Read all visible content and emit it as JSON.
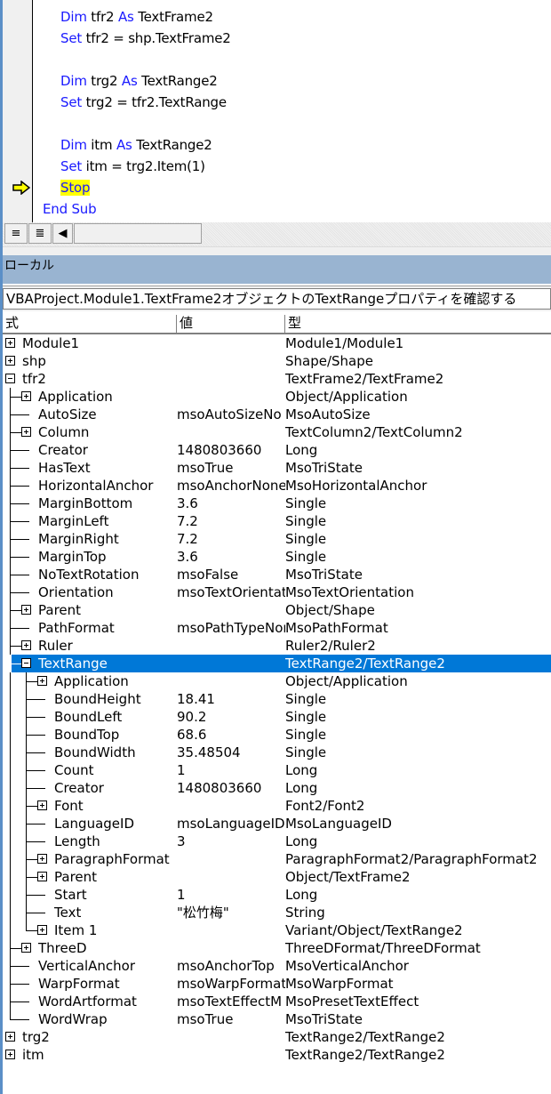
{
  "code": {
    "lines": [
      {
        "indent": 1,
        "parts": [
          {
            "t": "Dim",
            "kw": true
          },
          {
            "t": " tfr2 "
          },
          {
            "t": "As",
            "kw": true
          },
          {
            "t": " TextFrame2"
          }
        ]
      },
      {
        "indent": 1,
        "parts": [
          {
            "t": "Set",
            "kw": true
          },
          {
            "t": " tfr2 = shp.TextFrame2"
          }
        ]
      },
      {
        "indent": 1,
        "parts": []
      },
      {
        "indent": 1,
        "parts": [
          {
            "t": "Dim",
            "kw": true
          },
          {
            "t": " trg2 "
          },
          {
            "t": "As",
            "kw": true
          },
          {
            "t": " TextRange2"
          }
        ]
      },
      {
        "indent": 1,
        "parts": [
          {
            "t": "Set",
            "kw": true
          },
          {
            "t": " trg2 = tfr2.TextRange"
          }
        ]
      },
      {
        "indent": 1,
        "parts": []
      },
      {
        "indent": 1,
        "parts": [
          {
            "t": "Dim",
            "kw": true
          },
          {
            "t": " itm "
          },
          {
            "t": "As",
            "kw": true
          },
          {
            "t": " TextRange2"
          }
        ]
      },
      {
        "indent": 1,
        "parts": [
          {
            "t": "Set",
            "kw": true
          },
          {
            "t": " itm = trg2.Item(1)"
          }
        ]
      },
      {
        "indent": 1,
        "parts": [
          {
            "t": "Stop",
            "kw": true,
            "hl": true
          }
        ],
        "current": true
      },
      {
        "indent": 0,
        "parts": [
          {
            "t": "End Sub",
            "kw": true
          }
        ]
      }
    ],
    "execution_arrow_icon": "current-line-arrow-icon",
    "toolbar": {
      "procedure_view_icon": "≡",
      "full_module_view_icon": "≣",
      "scroll_left_icon": "◀"
    }
  },
  "locals": {
    "title": "ローカル",
    "context": "VBAProject.Module1.TextFrame2オブジェクトのTextRangeプロパティを確認する",
    "columns": [
      "式",
      "値",
      "型"
    ],
    "colors": {
      "selection": "#0078d7",
      "title_bar": "#99b4d1",
      "keyword": "#1a1aff",
      "highlight": "#ffff00"
    },
    "rows": [
      {
        "level": 0,
        "exp": "plus",
        "name": "Module1",
        "value": "",
        "type": "Module1/Module1"
      },
      {
        "level": 0,
        "exp": "plus",
        "name": "shp",
        "value": "",
        "type": "Shape/Shape"
      },
      {
        "level": 0,
        "exp": "minus",
        "name": "tfr2",
        "value": "",
        "type": "TextFrame2/TextFrame2"
      },
      {
        "level": 1,
        "exp": "plus",
        "name": "Application",
        "value": "",
        "type": "Object/Application"
      },
      {
        "level": 1,
        "exp": "",
        "name": "AutoSize",
        "value": "msoAutoSizeNo",
        "type": "MsoAutoSize"
      },
      {
        "level": 1,
        "exp": "plus",
        "name": "Column",
        "value": "",
        "type": "TextColumn2/TextColumn2"
      },
      {
        "level": 1,
        "exp": "",
        "name": "Creator",
        "value": "1480803660",
        "type": "Long"
      },
      {
        "level": 1,
        "exp": "",
        "name": "HasText",
        "value": "msoTrue",
        "type": "MsoTriState"
      },
      {
        "level": 1,
        "exp": "",
        "name": "HorizontalAnchor",
        "value": "msoAnchorNone",
        "type": "MsoHorizontalAnchor"
      },
      {
        "level": 1,
        "exp": "",
        "name": "MarginBottom",
        "value": "3.6",
        "type": "Single"
      },
      {
        "level": 1,
        "exp": "",
        "name": "MarginLeft",
        "value": "7.2",
        "type": "Single"
      },
      {
        "level": 1,
        "exp": "",
        "name": "MarginRight",
        "value": "7.2",
        "type": "Single"
      },
      {
        "level": 1,
        "exp": "",
        "name": "MarginTop",
        "value": "3.6",
        "type": "Single"
      },
      {
        "level": 1,
        "exp": "",
        "name": "NoTextRotation",
        "value": "msoFalse",
        "type": "MsoTriState"
      },
      {
        "level": 1,
        "exp": "",
        "name": "Orientation",
        "value": "msoTextOrientation",
        "type": "MsoTextOrientation"
      },
      {
        "level": 1,
        "exp": "plus",
        "name": "Parent",
        "value": "",
        "type": "Object/Shape"
      },
      {
        "level": 1,
        "exp": "",
        "name": "PathFormat",
        "value": "msoPathTypeNone",
        "type": "MsoPathFormat"
      },
      {
        "level": 1,
        "exp": "plus",
        "name": "Ruler",
        "value": "",
        "type": "Ruler2/Ruler2"
      },
      {
        "level": 1,
        "exp": "minus",
        "name": "TextRange",
        "value": "",
        "type": "TextRange2/TextRange2",
        "selected": true
      },
      {
        "level": 2,
        "exp": "plus",
        "name": "Application",
        "value": "",
        "type": "Object/Application"
      },
      {
        "level": 2,
        "exp": "",
        "name": "BoundHeight",
        "value": "18.41",
        "type": "Single"
      },
      {
        "level": 2,
        "exp": "",
        "name": "BoundLeft",
        "value": "90.2",
        "type": "Single"
      },
      {
        "level": 2,
        "exp": "",
        "name": "BoundTop",
        "value": "68.6",
        "type": "Single"
      },
      {
        "level": 2,
        "exp": "",
        "name": "BoundWidth",
        "value": "35.48504",
        "type": "Single"
      },
      {
        "level": 2,
        "exp": "",
        "name": "Count",
        "value": "1",
        "type": "Long"
      },
      {
        "level": 2,
        "exp": "",
        "name": "Creator",
        "value": "1480803660",
        "type": "Long"
      },
      {
        "level": 2,
        "exp": "plus",
        "name": "Font",
        "value": "",
        "type": "Font2/Font2"
      },
      {
        "level": 2,
        "exp": "",
        "name": "LanguageID",
        "value": "msoLanguageID",
        "type": "MsoLanguageID"
      },
      {
        "level": 2,
        "exp": "",
        "name": "Length",
        "value": "3",
        "type": "Long"
      },
      {
        "level": 2,
        "exp": "plus",
        "name": "ParagraphFormat",
        "value": "",
        "type": "ParagraphFormat2/ParagraphFormat2"
      },
      {
        "level": 2,
        "exp": "plus",
        "name": "Parent",
        "value": "",
        "type": "Object/TextFrame2"
      },
      {
        "level": 2,
        "exp": "",
        "name": "Start",
        "value": "1",
        "type": "Long"
      },
      {
        "level": 2,
        "exp": "",
        "name": "Text",
        "value": "\"松竹梅\"",
        "type": "String"
      },
      {
        "level": 2,
        "exp": "plus",
        "name": "Item 1",
        "value": "",
        "type": "Variant/Object/TextRange2",
        "last": true
      },
      {
        "level": 1,
        "exp": "plus",
        "name": "ThreeD",
        "value": "",
        "type": "ThreeDFormat/ThreeDFormat"
      },
      {
        "level": 1,
        "exp": "",
        "name": "VerticalAnchor",
        "value": "msoAnchorTop",
        "type": "MsoVerticalAnchor"
      },
      {
        "level": 1,
        "exp": "",
        "name": "WarpFormat",
        "value": "msoWarpFormat",
        "type": "MsoWarpFormat"
      },
      {
        "level": 1,
        "exp": "",
        "name": "WordArtformat",
        "value": "msoTextEffectM",
        "type": "MsoPresetTextEffect"
      },
      {
        "level": 1,
        "exp": "",
        "name": "WordWrap",
        "value": "msoTrue",
        "type": "MsoTriState",
        "last": true
      },
      {
        "level": 0,
        "exp": "plus",
        "name": "trg2",
        "value": "",
        "type": "TextRange2/TextRange2"
      },
      {
        "level": 0,
        "exp": "plus",
        "name": "itm",
        "value": "",
        "type": "TextRange2/TextRange2"
      }
    ]
  }
}
